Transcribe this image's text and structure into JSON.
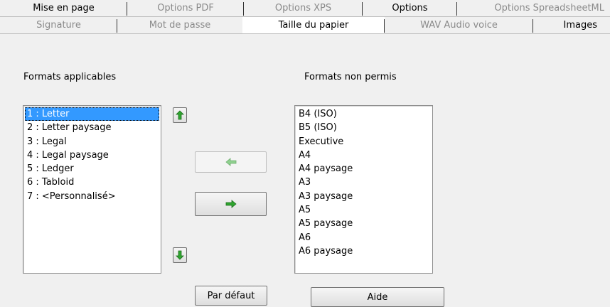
{
  "tabs": {
    "row1": [
      {
        "label": "Mise en page",
        "selected": false,
        "enabled": true
      },
      {
        "label": "Options PDF",
        "selected": false,
        "enabled": false
      },
      {
        "label": "Options XPS",
        "selected": false,
        "enabled": false
      },
      {
        "label": "Options",
        "selected": false,
        "enabled": true
      },
      {
        "label": "Options SpreadsheetML",
        "selected": false,
        "enabled": false
      }
    ],
    "row2": [
      {
        "label": "Signature",
        "selected": false,
        "enabled": false
      },
      {
        "label": "Mot de passe",
        "selected": false,
        "enabled": false
      },
      {
        "label": "Taille du papier",
        "selected": true,
        "enabled": true
      },
      {
        "label": "WAV Audio voice",
        "selected": false,
        "enabled": false
      },
      {
        "label": "Images",
        "selected": false,
        "enabled": true
      }
    ]
  },
  "left_panel": {
    "label": "Formats applicables",
    "items": [
      "1 : Letter",
      "2 : Letter paysage",
      "3 : Legal",
      "4 : Legal paysage",
      "5 : Ledger",
      "6 : Tabloid",
      "7 : <Personnalisé>"
    ],
    "selected_index": 0
  },
  "right_panel": {
    "label": "Formats non permis",
    "items": [
      "B4 (ISO)",
      "B5 (ISO)",
      "Executive",
      "A4",
      "A4 paysage",
      "A3",
      "A3 paysage",
      "A5",
      "A5 paysage",
      "A6",
      "A6 paysage"
    ]
  },
  "buttons": {
    "move_up_icon": "green-arrow-up-icon",
    "move_down_icon": "green-arrow-down-icon",
    "move_left_icon": "green-arrow-left-icon",
    "move_right_icon": "green-arrow-right-icon",
    "default_label": "Par défaut",
    "help_label": "Aide"
  },
  "colors": {
    "arrow_green": "#2fa52f",
    "arrow_dim_green": "#8fd08f",
    "selection": "#3399ff"
  }
}
